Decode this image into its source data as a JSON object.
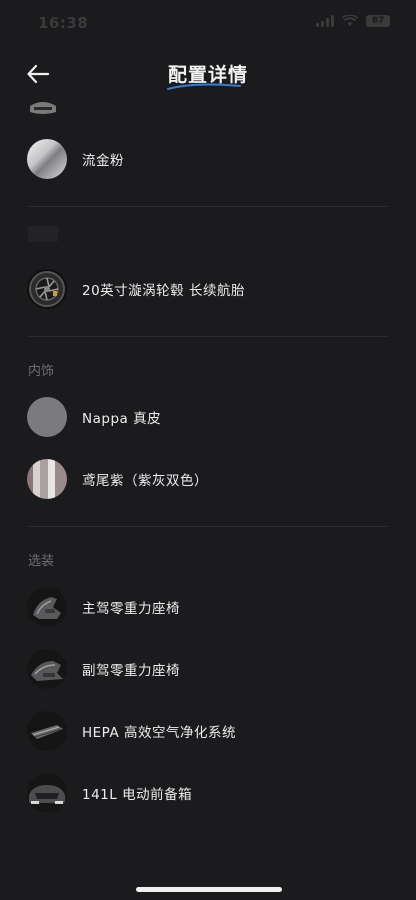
{
  "status": {
    "time": "16:38",
    "battery": "87"
  },
  "nav": {
    "title": "配置详情"
  },
  "sections": {
    "exterior_color": {
      "items": [
        {
          "label": "流金粉",
          "icon": "silver-gradient-swatch"
        }
      ]
    },
    "wheels": {
      "label_partial": "",
      "items": [
        {
          "label": "20英寸漩涡轮毂 长续航胎",
          "icon": "wheel-thumbnail"
        }
      ]
    },
    "interior": {
      "label": "内饰",
      "items": [
        {
          "label": "Nappa 真皮",
          "icon": "leather-gray-swatch"
        },
        {
          "label": "鸢尾紫（紫灰双色）",
          "icon": "two-tone-stripe-swatch"
        }
      ]
    },
    "options": {
      "label": "选装",
      "items": [
        {
          "label": "主驾零重力座椅",
          "icon": "seat-thumbnail"
        },
        {
          "label": "副驾零重力座椅",
          "icon": "seat-thumbnail"
        },
        {
          "label": "HEPA 高效空气净化系统",
          "icon": "filter-thumbnail"
        },
        {
          "label": "141L 电动前备箱",
          "icon": "frunk-thumbnail"
        }
      ]
    }
  },
  "colors": {
    "background": "#1b1b1d",
    "divider": "#2c2c2f",
    "section_label": "#6e6e72",
    "text": "#ececec",
    "accent_swoosh": "#2e7fd6"
  }
}
